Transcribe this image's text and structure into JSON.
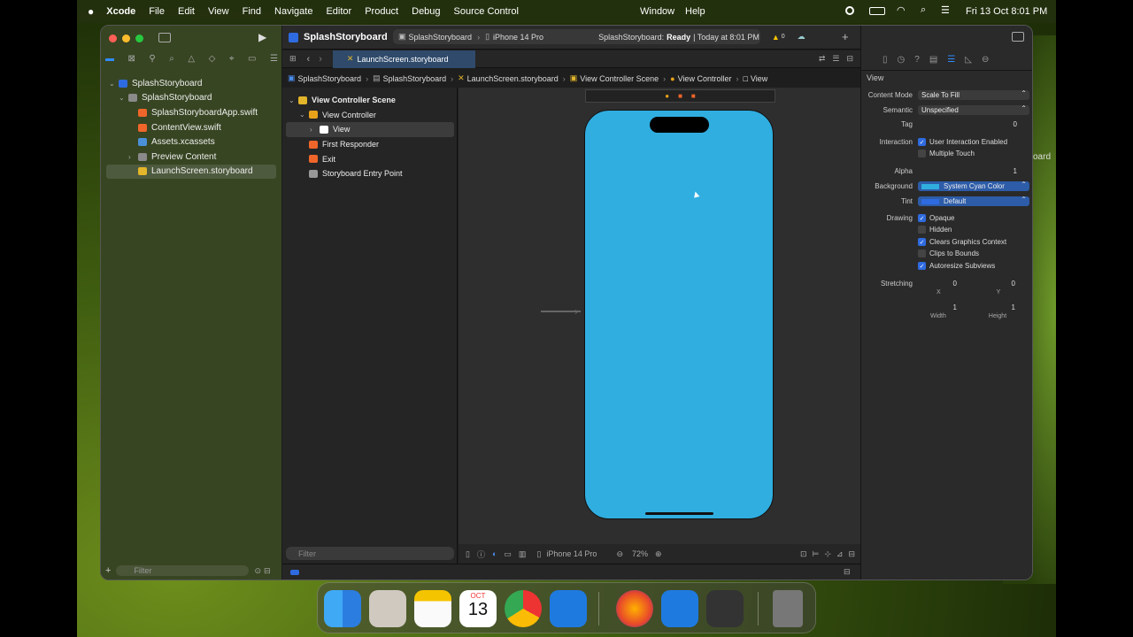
{
  "menubar": {
    "apple": "",
    "app": "Xcode",
    "items": [
      "File",
      "Edit",
      "View",
      "Find",
      "Navigate",
      "Editor",
      "Product",
      "Debug",
      "Source Control",
      "Window",
      "Help"
    ],
    "clock": "Fri 13 Oct  8:01 PM"
  },
  "toolbar": {
    "project": "SplashStoryboard",
    "scheme": "SplashStoryboard",
    "device": "iPhone 14 Pro",
    "status_project": "SplashStoryboard:",
    "status_state": "Ready",
    "status_time": "| Today at 8:01 PM",
    "warnings": "0"
  },
  "navigator": {
    "items": [
      {
        "label": "SplashStoryboard",
        "indent": 0,
        "disclosure": "v",
        "icon": "project-icon",
        "color": "#2f6be0"
      },
      {
        "label": "SplashStoryboard",
        "indent": 1,
        "disclosure": "v",
        "icon": "folder-icon",
        "color": "#8a8a8a"
      },
      {
        "label": "SplashStoryboardApp.swift",
        "indent": 2,
        "disclosure": "",
        "icon": "swift-icon",
        "color": "#f0662a"
      },
      {
        "label": "ContentView.swift",
        "indent": 2,
        "disclosure": "",
        "icon": "swift-icon",
        "color": "#f0662a"
      },
      {
        "label": "Assets.xcassets",
        "indent": 2,
        "disclosure": "",
        "icon": "assets-icon",
        "color": "#4a90d9"
      },
      {
        "label": "Preview Content",
        "indent": 2,
        "disclosure": ">",
        "icon": "folder-icon",
        "color": "#8a8a8a"
      },
      {
        "label": "LaunchScreen.storyboard",
        "indent": 2,
        "disclosure": "",
        "icon": "storyboard-icon",
        "color": "#e2b52b",
        "selected": true
      }
    ],
    "filter_placeholder": "Filter"
  },
  "editor": {
    "tab": "LaunchScreen.storyboard",
    "breadcrumb": [
      "SplashStoryboard",
      "SplashStoryboard",
      "LaunchScreen.storyboard",
      "View Controller Scene",
      "View Controller",
      "View"
    ]
  },
  "outline": {
    "items": [
      {
        "label": "View Controller Scene",
        "indent": 0,
        "disclosure": "v",
        "bold": true,
        "color": "#e2b52b"
      },
      {
        "label": "View Controller",
        "indent": 1,
        "disclosure": "v",
        "color": "#e8a21a"
      },
      {
        "label": "View",
        "indent": 2,
        "disclosure": ">",
        "color": "#ffffff",
        "selected": true
      },
      {
        "label": "First Responder",
        "indent": 1,
        "disclosure": "",
        "color": "#f0662a"
      },
      {
        "label": "Exit",
        "indent": 1,
        "disclosure": "",
        "color": "#f0662a"
      },
      {
        "label": "Storyboard Entry Point",
        "indent": 1,
        "disclosure": "",
        "color": "#999999"
      }
    ],
    "filter_placeholder": "Filter"
  },
  "canvas": {
    "device": "iPhone 14 Pro",
    "zoom": "72%",
    "view_color": "#30aee0"
  },
  "inspector": {
    "section": "View",
    "content_mode_label": "Content Mode",
    "content_mode": "Scale To Fill",
    "semantic_label": "Semantic",
    "semantic": "Unspecified",
    "tag_label": "Tag",
    "tag": "0",
    "interaction_label": "Interaction",
    "user_interaction": "User Interaction Enabled",
    "multiple_touch": "Multiple Touch",
    "alpha_label": "Alpha",
    "alpha": "1",
    "background_label": "Background",
    "background": "System Cyan Color",
    "tint_label": "Tint",
    "tint": "Default",
    "drawing_label": "Drawing",
    "opaque": "Opaque",
    "hidden": "Hidden",
    "clears": "Clears Graphics Context",
    "clips": "Clips to Bounds",
    "autoresize": "Autoresize Subviews",
    "stretching_label": "Stretching",
    "sx": "0",
    "sy": "0",
    "sw": "1",
    "sh": "1",
    "x_label": "X",
    "y_label": "Y",
    "w_label": "Width",
    "h_label": "Height",
    "bg_swatch": "#30aee0",
    "tint_swatch": "#2f6be0"
  },
  "dock": {
    "calendar_month": "OCT",
    "calendar_day": "13"
  },
  "behind_text": "oard"
}
